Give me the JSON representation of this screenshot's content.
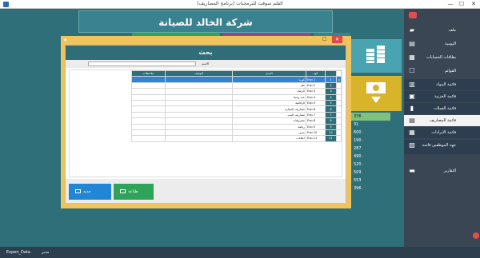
{
  "window": {
    "title": "القلم سوفت للبرمجيات (برنامج المصاريف)",
    "minimize": "—",
    "maximize": "☐",
    "close": "✕"
  },
  "banner": {
    "company": "شركة الخالد للصيانة"
  },
  "tiles": [
    {
      "color": "#2fa35a"
    },
    {
      "color": "#8b4a8f"
    },
    {
      "color": "#3b8290"
    }
  ],
  "values": [
    "376",
    "31",
    "600",
    "190",
    "287",
    "490",
    "520",
    "509",
    "553",
    "396"
  ],
  "sidebar": {
    "items": [
      {
        "label": "ملف",
        "icon": "folder-icon"
      },
      {
        "label": "اليومية",
        "icon": "journal-icon"
      },
      {
        "label": "بطاقات الحسابات",
        "icon": "cards-icon"
      },
      {
        "label": "القوائم",
        "icon": "list-icon"
      },
      {
        "label": "قائمة البنوك",
        "icon": "bank-icon"
      },
      {
        "label": "قائمة الخزنية",
        "icon": "safe-icon"
      },
      {
        "label": "قائمة العملات",
        "icon": "currency-icon"
      },
      {
        "label": "قائمة المصاريف",
        "icon": "expense-icon"
      },
      {
        "label": "قائمة الايرادات",
        "icon": "revenue-icon"
      },
      {
        "label": "جهة الموظفين قائمة",
        "icon": "employees-icon"
      },
      {
        "label": "التقارير",
        "icon": "reports-icon"
      }
    ]
  },
  "statusbar": {
    "form": "Expen_Data",
    "user": "مدير"
  },
  "dialog": {
    "header": "بحث",
    "search_label": "الاسم",
    "search_value": "",
    "columns": {
      "code": "كود",
      "name": "الاسم",
      "desc": "الوصف",
      "notes": "ملاحظات"
    },
    "rows": [
      {
        "idx": "1",
        "code": "Exp.1",
        "name": "كهربا",
        "desc": "",
        "notes": ""
      },
      {
        "idx": "2",
        "code": "Exp.2",
        "name": "نقل",
        "desc": "",
        "notes": ""
      },
      {
        "idx": "3",
        "code": "Exp.3",
        "name": "الرصاد",
        "desc": "",
        "notes": ""
      },
      {
        "idx": "4",
        "code": "Exp.4",
        "name": "عدد وعياد",
        "desc": "",
        "notes": ""
      },
      {
        "idx": "5",
        "code": "Exp.5",
        "name": "الرفاهية",
        "desc": "",
        "notes": ""
      },
      {
        "idx": "6",
        "code": "Exp.6",
        "name": "مصاريف السيارة",
        "desc": "",
        "notes": ""
      },
      {
        "idx": "7",
        "code": "Exp.7",
        "name": "مصاريف البيت",
        "desc": "",
        "notes": ""
      },
      {
        "idx": "8",
        "code": "Exp.8",
        "name": "مصروفات",
        "desc": "",
        "notes": ""
      },
      {
        "idx": "9",
        "code": "Exp.9",
        "name": "رياضة",
        "desc": "",
        "notes": ""
      },
      {
        "idx": "10",
        "code": "Exp.10",
        "name": "بنزين",
        "desc": "",
        "notes": ""
      },
      {
        "idx": "11",
        "code": "Exp.11",
        "name": "اعلانات",
        "desc": "",
        "notes": ""
      }
    ],
    "new_label": "جديد",
    "print_label": "طباعة"
  }
}
